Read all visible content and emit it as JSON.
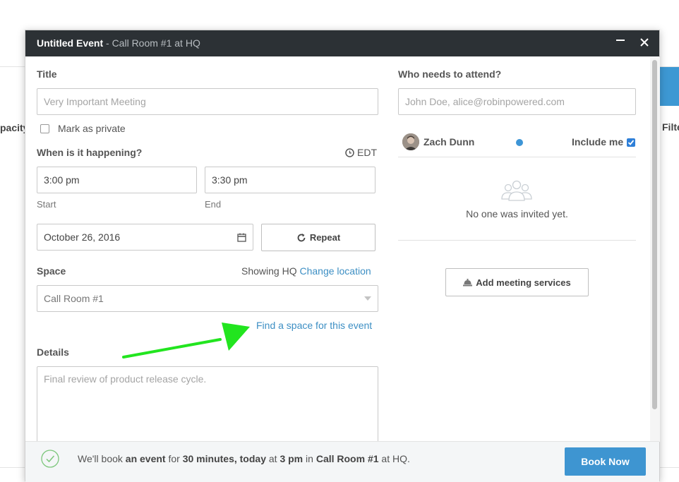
{
  "background": {
    "left_text": "pacity",
    "right_text": "Filte"
  },
  "modal": {
    "title": "Untitled Event",
    "subtitle": "- Call Room #1 at HQ",
    "title_label": "Title",
    "title_placeholder": "Very Important Meeting",
    "private_label": "Mark as private",
    "when_label": "When is it happening?",
    "timezone": "EDT",
    "start_time": "3:00 pm",
    "start_label": "Start",
    "end_time": "3:30 pm",
    "end_label": "End",
    "date": "October 26, 2016",
    "repeat_label": "Repeat",
    "space_label": "Space",
    "showing_text": "Showing HQ",
    "change_location": "Change location",
    "space_value": "Call Room #1",
    "find_space_link": "Find a space for this event",
    "details_label": "Details",
    "details_placeholder": "Final review of product release cycle.",
    "attend_label": "Who needs to attend?",
    "attend_placeholder": "John Doe, alice@robinpowered.com",
    "organizer_name": "Zach Dunn",
    "include_me_label": "Include me",
    "include_me_checked": true,
    "empty_invites": "No one was invited yet.",
    "services_button": "Add meeting services"
  },
  "footer": {
    "prefix": "We'll book",
    "event_type": "an event",
    "mid1": "for",
    "duration_when": "30 minutes, today",
    "mid2": "at",
    "time": "3 pm",
    "mid3": "in",
    "room": "Call Room #1",
    "suffix": "at HQ.",
    "book_button": "Book Now"
  },
  "colors": {
    "accent": "#3e95d1",
    "titlebar": "#2c3135",
    "annotation_arrow": "#22e51f"
  }
}
